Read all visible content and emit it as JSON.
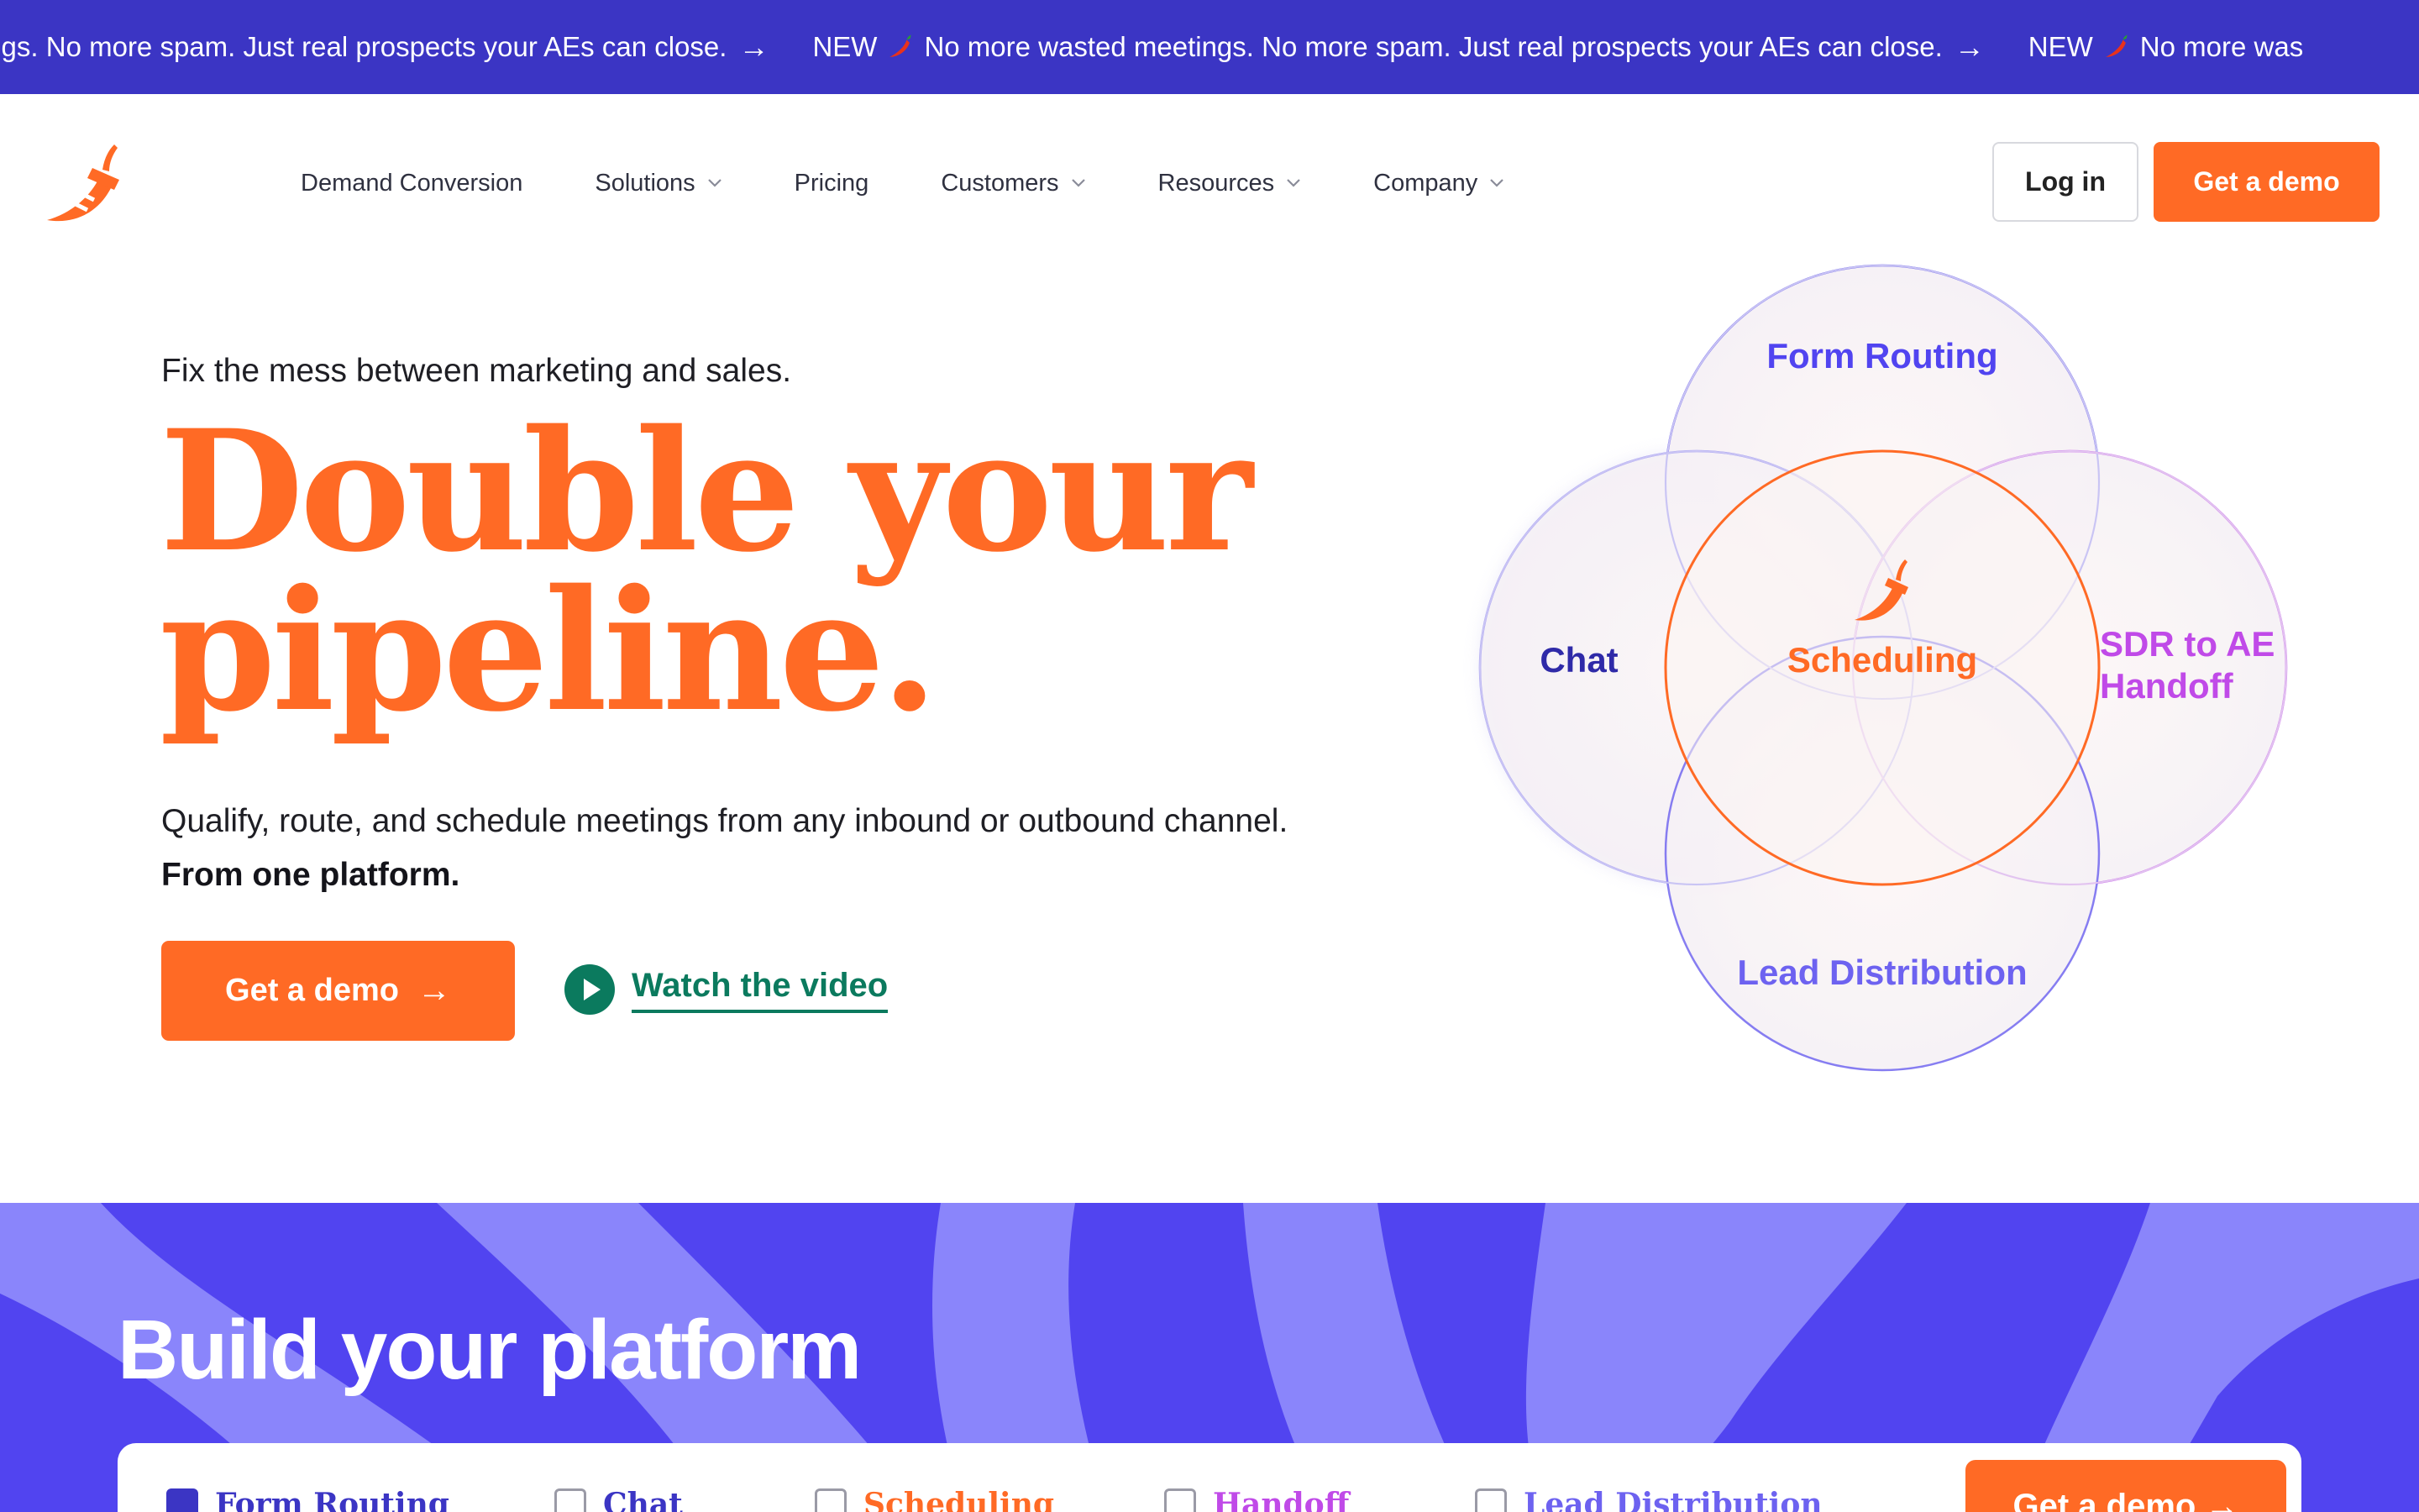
{
  "banner": {
    "segments": [
      {
        "new": "",
        "text": "eetings. No more spam. Just real prospects your AEs can close.",
        "arrow": "→"
      },
      {
        "new": "NEW",
        "text": "No more wasted meetings. No more spam. Just real prospects your AEs can close.",
        "arrow": "→"
      },
      {
        "new": "NEW",
        "text": "No more was",
        "arrow": ""
      }
    ]
  },
  "nav": {
    "links": [
      {
        "label": "Demand Conversion",
        "dropdown": false
      },
      {
        "label": "Solutions",
        "dropdown": true
      },
      {
        "label": "Pricing",
        "dropdown": false
      },
      {
        "label": "Customers",
        "dropdown": true
      },
      {
        "label": "Resources",
        "dropdown": true
      },
      {
        "label": "Company",
        "dropdown": true
      }
    ],
    "login_label": "Log in",
    "demo_label": "Get a demo"
  },
  "hero": {
    "eyebrow": "Fix the mess between marketing and sales.",
    "headline_line1": "Double your",
    "headline_line2": "pipeline.",
    "sub_text": "Qualify, route, and schedule meetings from any inbound or outbound channel.",
    "sub_bold": "From one platform.",
    "cta_label": "Get a demo",
    "cta_arrow": "→",
    "video_label": "Watch the video"
  },
  "venn": {
    "top": "Form Routing",
    "left": "Chat",
    "center": "Scheduling",
    "right_line1": "SDR to AE",
    "right_line2": "Handoff",
    "bottom": "Lead Distribution"
  },
  "platform": {
    "title": "Build your platform",
    "options": [
      {
        "label": "Form Routing",
        "checked": true,
        "color": "#3b35c4"
      },
      {
        "label": "Chat",
        "checked": false,
        "color": "#3b35c4"
      },
      {
        "label": "Scheduling",
        "checked": false,
        "color": "#ff6a25"
      },
      {
        "label": "Handoff",
        "checked": false,
        "color": "#c04ae8"
      },
      {
        "label": "Lead Distribution",
        "checked": false,
        "color": "#6d62f0"
      }
    ],
    "cta_label": "Get a demo →"
  },
  "colors": {
    "brand_orange": "#ff6a25",
    "banner_indigo": "#3b35c4",
    "section_purple": "#5144f0",
    "video_green": "#0b7a5e",
    "handoff_magenta": "#c04ae8"
  },
  "icons": [
    "chili-logo-icon",
    "chevron-down-icon",
    "play-icon",
    "arrow-right-icon",
    "checkbox-icon"
  ]
}
